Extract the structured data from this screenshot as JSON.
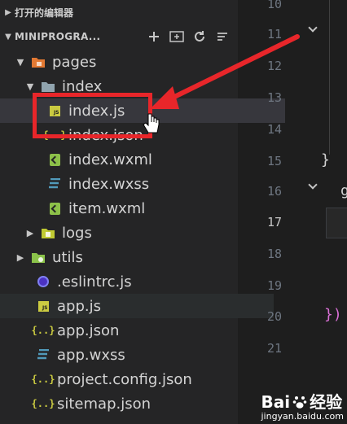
{
  "sidebar": {
    "open_editors_title": "打开的编辑器",
    "project_title": "MINIPROGRA...",
    "actions": [
      {
        "name": "new-file-icon"
      },
      {
        "name": "new-folder-icon"
      },
      {
        "name": "refresh-icon"
      },
      {
        "name": "collapse-all-icon"
      }
    ],
    "tree": [
      {
        "label": "pages",
        "kind": "folder-open"
      },
      {
        "label": "index",
        "kind": "folder-open"
      },
      {
        "label": "index.js",
        "kind": "js"
      },
      {
        "label": "index.json",
        "kind": "json"
      },
      {
        "label": "index.wxml",
        "kind": "wxml"
      },
      {
        "label": "index.wxss",
        "kind": "wxss"
      },
      {
        "label": "item.wxml",
        "kind": "wxml"
      },
      {
        "label": "logs",
        "kind": "folder"
      },
      {
        "label": "utils",
        "kind": "folder"
      },
      {
        "label": ".eslintrc.js",
        "kind": "eslint"
      },
      {
        "label": "app.js",
        "kind": "js"
      },
      {
        "label": "app.json",
        "kind": "json"
      },
      {
        "label": "app.wxss",
        "kind": "wxss"
      },
      {
        "label": "project.config.json",
        "kind": "json"
      },
      {
        "label": "sitemap.json",
        "kind": "json"
      }
    ],
    "icon_glyphs": {
      "js": "JS",
      "json": "{..}"
    }
  },
  "editor": {
    "line_numbers": [
      "10",
      "11",
      "12",
      "13",
      "14",
      "15",
      "16",
      "17",
      "18",
      "19",
      "20",
      "21"
    ],
    "current_line": "17",
    "code_fragments": [
      "}",
      "g",
      "})"
    ]
  },
  "colors": {
    "highlight_box": "#e8262a",
    "folder": "#e37933",
    "js": "#cbcb41",
    "wxml": "#8dc149",
    "wxss": "#519aba"
  },
  "watermark": {
    "brand_text": "Bai",
    "brand_cn": "经验",
    "url": "jingyan.baidu.com"
  }
}
